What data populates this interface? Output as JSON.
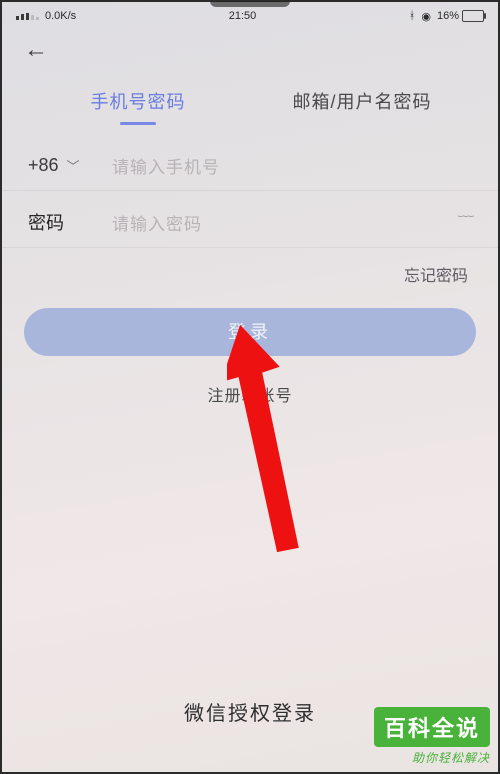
{
  "statusbar": {
    "carrier": "0.0K/s",
    "time": "21:50",
    "battery_pct": "16%"
  },
  "nav": {
    "back_glyph": "←"
  },
  "tabs": {
    "phone": "手机号密码",
    "email": "邮箱/用户名密码"
  },
  "phone_field": {
    "country_code": "+86",
    "placeholder": "请输入手机号"
  },
  "password_field": {
    "label": "密码",
    "placeholder": "请输入密码"
  },
  "links": {
    "forgot": "忘记密码",
    "register": "注册新账号"
  },
  "buttons": {
    "login": "登录"
  },
  "footer": {
    "wechat_login": "微信授权登录"
  },
  "watermark": {
    "title": "百科全说",
    "subtitle": "助你轻松解决"
  },
  "icons": {
    "chevron_down": "﹀",
    "eye_closed": "﹋"
  }
}
